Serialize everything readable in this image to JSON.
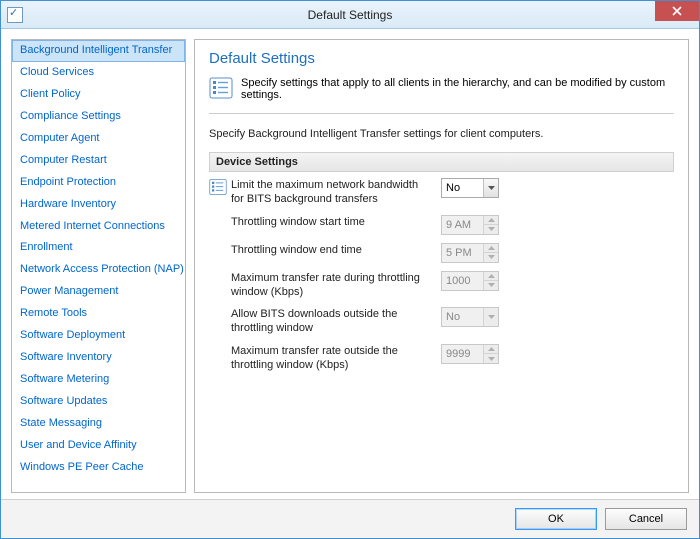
{
  "window": {
    "title": "Default Settings"
  },
  "nav": {
    "items": [
      "Background Intelligent Transfer",
      "Cloud Services",
      "Client Policy",
      "Compliance Settings",
      "Computer Agent",
      "Computer Restart",
      "Endpoint Protection",
      "Hardware Inventory",
      "Metered Internet Connections",
      "Enrollment",
      "Network Access Protection (NAP)",
      "Power Management",
      "Remote Tools",
      "Software Deployment",
      "Software Inventory",
      "Software Metering",
      "Software Updates",
      "State Messaging",
      "User and Device Affinity",
      "Windows PE Peer Cache"
    ],
    "selected_index": 0
  },
  "content": {
    "heading": "Default Settings",
    "intro": "Specify settings that apply to all clients in the hierarchy, and can be modified by custom settings.",
    "section_desc": "Specify Background Intelligent Transfer settings for client computers.",
    "group_title": "Device Settings",
    "settings": [
      {
        "label": "Limit the maximum network bandwidth for BITS background transfers",
        "value": "No",
        "type": "dropdown",
        "enabled": true,
        "icon": true
      },
      {
        "label": "Throttling window start time",
        "value": "9 AM",
        "type": "spinner",
        "enabled": false,
        "icon": false
      },
      {
        "label": "Throttling window end time",
        "value": "5 PM",
        "type": "spinner",
        "enabled": false,
        "icon": false
      },
      {
        "label": "Maximum transfer rate during throttling window (Kbps)",
        "value": "1000",
        "type": "spinner",
        "enabled": false,
        "icon": false
      },
      {
        "label": "Allow BITS downloads outside the throttling window",
        "value": "No",
        "type": "dropdown",
        "enabled": false,
        "icon": false
      },
      {
        "label": "Maximum transfer rate outside the throttling window (Kbps)",
        "value": "9999",
        "type": "spinner",
        "enabled": false,
        "icon": false
      }
    ]
  },
  "footer": {
    "ok": "OK",
    "cancel": "Cancel"
  }
}
